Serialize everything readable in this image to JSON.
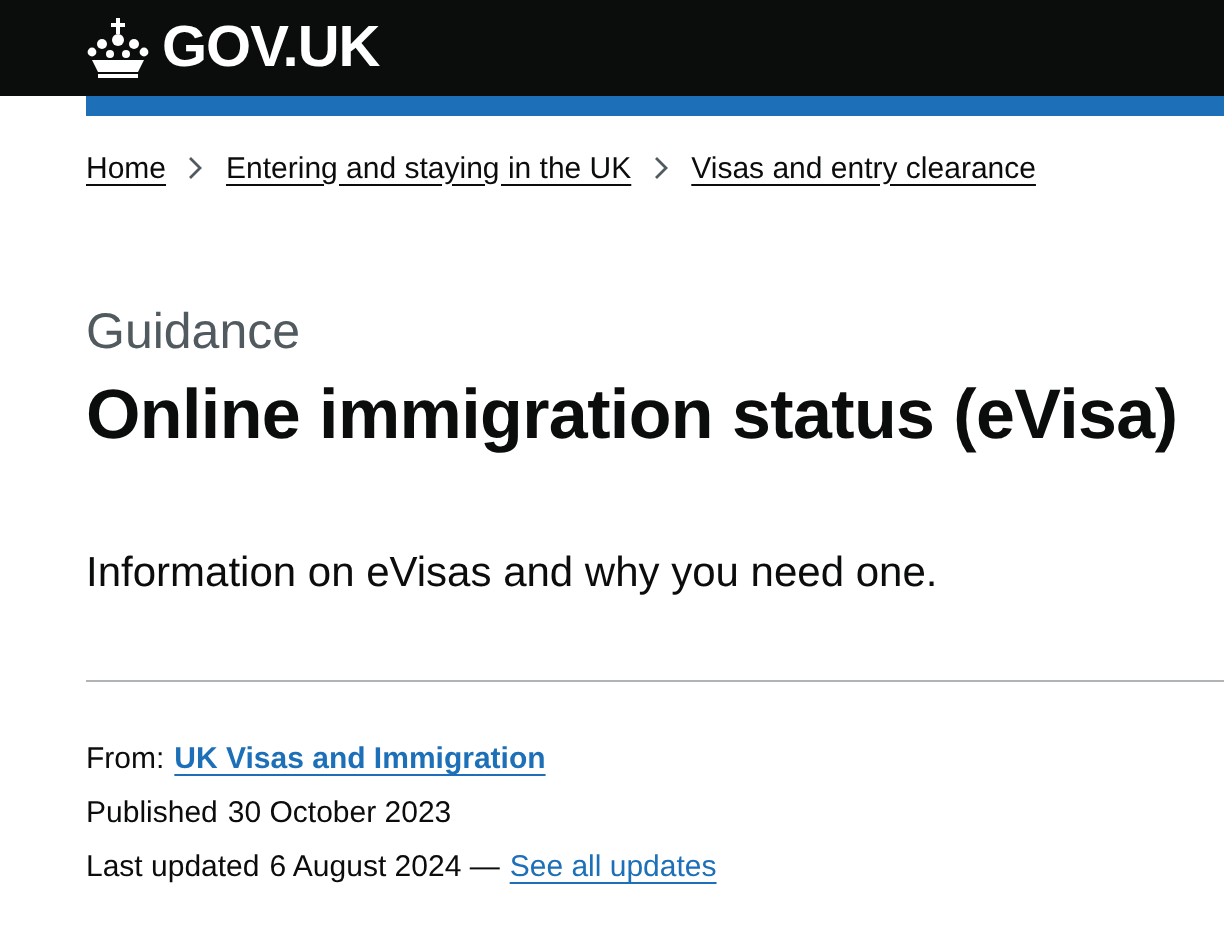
{
  "header": {
    "logo_text": "GOV.UK"
  },
  "breadcrumbs": [
    {
      "label": "Home"
    },
    {
      "label": "Entering and staying in the UK"
    },
    {
      "label": "Visas and entry clearance"
    }
  ],
  "caption": "Guidance",
  "title": "Online immigration status (eVisa)",
  "lead": "Information on eVisas and why you need one.",
  "metadata": {
    "from_label": "From:",
    "from_link": "UK Visas and Immigration",
    "published_label": "Published",
    "published_date": "30 October 2023",
    "updated_label": "Last updated",
    "updated_date": "6 August 2024 —",
    "updates_link": "See all updates"
  }
}
